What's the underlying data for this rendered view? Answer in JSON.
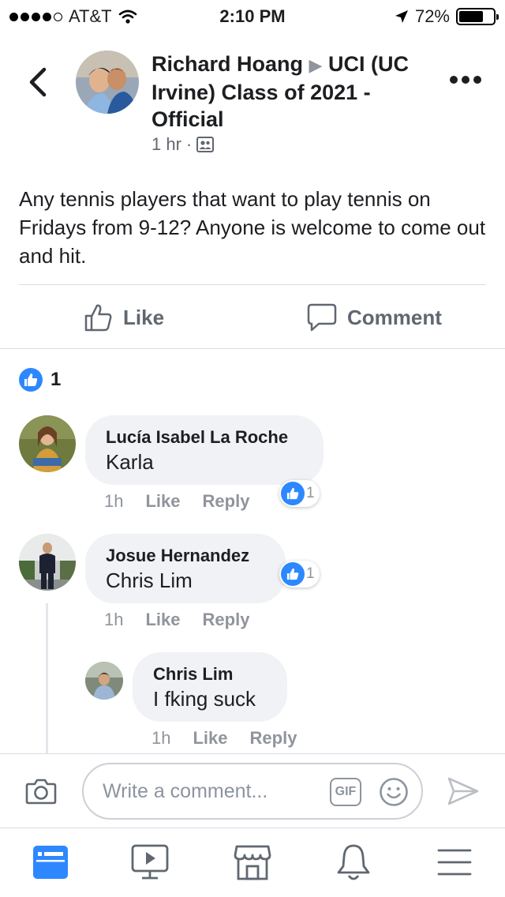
{
  "status_bar": {
    "carrier": "AT&T",
    "time": "2:10 PM",
    "battery": "72%",
    "battery_level": 0.72
  },
  "post": {
    "author": "Richard Hoang",
    "group": "UCI (UC Irvine) Class of 2021 - Official",
    "time": "1 hr",
    "privacy_icon": "group-members-icon",
    "body": "Any tennis players that want to play tennis on Fridays from 9-12? Anyone is welcome to come out and hit."
  },
  "actions": {
    "like_label": "Like",
    "comment_label": "Comment"
  },
  "reactions": {
    "count": "1"
  },
  "comments": [
    {
      "author": "Lucía Isabel La Roche",
      "text": "Karla",
      "time": "1h",
      "like_label": "Like",
      "reply_label": "Reply",
      "reaction_count": "1"
    },
    {
      "author": "Josue Hernandez",
      "text": "Chris Lim",
      "time": "1h",
      "like_label": "Like",
      "reply_label": "Reply",
      "reaction_count": "1",
      "replies": [
        {
          "author": "Chris Lim",
          "text": "I fking suck",
          "time": "1h",
          "like_label": "Like",
          "reply_label": "Reply"
        }
      ]
    }
  ],
  "composer": {
    "placeholder": "Write a comment...",
    "gif_label": "GIF"
  },
  "colors": {
    "accent": "#2d88ff",
    "muted": "#90949c",
    "bubble": "#f0f2f5"
  },
  "tabbar": {
    "items": [
      "news-feed-icon",
      "watch-video-icon",
      "marketplace-icon",
      "notifications-bell-icon",
      "menu-icon"
    ],
    "active": "news-feed-icon"
  }
}
